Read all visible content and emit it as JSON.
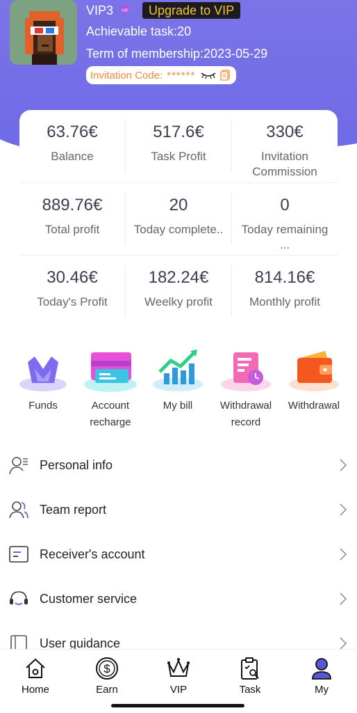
{
  "header": {
    "vip_level": "VIP3",
    "vip_badge_text": "VIP",
    "upgrade_label": "Upgrade to VIP",
    "achievable_task": "Achievable task:20",
    "membership_term": "Term of membership:2023-05-29",
    "invitation_label": "Invitation Code:",
    "invitation_code": "******"
  },
  "stats": [
    {
      "value": "63.76€",
      "label": "Balance"
    },
    {
      "value": "517.6€",
      "label": "Task Profit"
    },
    {
      "value": "330€",
      "label": "Invitation Commission"
    },
    {
      "value": "889.76€",
      "label": "Total profit"
    },
    {
      "value": "20",
      "label": "Today complete.."
    },
    {
      "value": "0",
      "label": "Today remaining ..."
    },
    {
      "value": "30.46€",
      "label": "Today's Profit"
    },
    {
      "value": "182.24€",
      "label": "Weelky profit"
    },
    {
      "value": "814.16€",
      "label": "Monthly profit"
    }
  ],
  "actions": [
    {
      "label": "Funds",
      "icon": "funds-icon"
    },
    {
      "label": "Account recharge",
      "icon": "card-icon"
    },
    {
      "label": "My bill",
      "icon": "chart-icon"
    },
    {
      "label": "Withdrawal record",
      "icon": "record-icon"
    },
    {
      "label": "Withdrawal",
      "icon": "wallet-icon"
    }
  ],
  "menu": [
    {
      "label": "Personal info",
      "icon": "person-icon"
    },
    {
      "label": "Team report",
      "icon": "team-icon"
    },
    {
      "label": "Receiver's account",
      "icon": "account-card-icon"
    },
    {
      "label": "Customer service",
      "icon": "headset-icon"
    },
    {
      "label": "User guidance",
      "icon": "book-icon"
    }
  ],
  "nav": [
    {
      "label": "Home",
      "icon": "home-icon"
    },
    {
      "label": "Earn",
      "icon": "dollar-icon"
    },
    {
      "label": "VIP",
      "icon": "crown-icon"
    },
    {
      "label": "Task",
      "icon": "clipboard-icon"
    },
    {
      "label": "My",
      "icon": "user-icon",
      "active": true
    }
  ],
  "colors": {
    "header_bg": "#7b74e8",
    "upgrade_text": "#f3c43a",
    "invite_text": "#f08a3c",
    "active_nav": "#5a56d6"
  }
}
